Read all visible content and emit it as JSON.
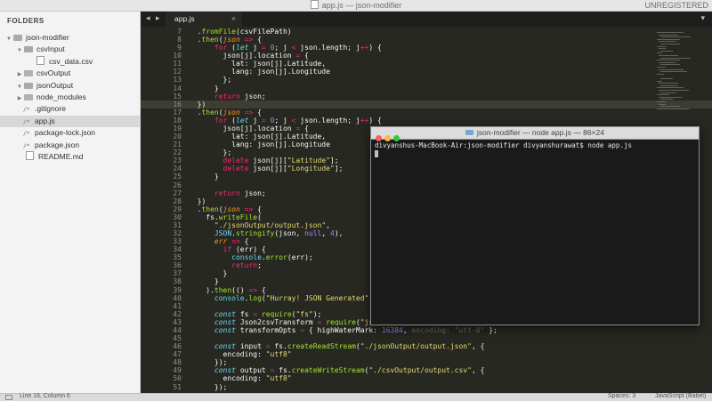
{
  "window": {
    "title": "app.js — json-modifier",
    "registration": "UNREGISTERED"
  },
  "sidebar": {
    "heading": "FOLDERS",
    "items": [
      {
        "label": "json-modifier",
        "kind": "folder-open",
        "depth": 0
      },
      {
        "label": "csvInput",
        "kind": "folder-open",
        "depth": 1
      },
      {
        "label": "csv_data.csv",
        "kind": "file",
        "depth": 2
      },
      {
        "label": "csvOutput",
        "kind": "folder-closed",
        "depth": 1
      },
      {
        "label": "jsonOutput",
        "kind": "folder-open",
        "depth": 1
      },
      {
        "label": "node_modules",
        "kind": "folder-closed",
        "depth": 1
      },
      {
        "label": ".gitignore",
        "kind": "js-file",
        "depth": 1
      },
      {
        "label": "app.js",
        "kind": "js-file",
        "depth": 1,
        "selected": true
      },
      {
        "label": "package-lock.json",
        "kind": "js-file",
        "depth": 1
      },
      {
        "label": "package.json",
        "kind": "js-file",
        "depth": 1
      },
      {
        "label": "README.md",
        "kind": "file",
        "depth": 1
      }
    ]
  },
  "tabs": {
    "nav_glyphs": "◂ ▸",
    "active_tab": "app.js",
    "close_glyph": "×",
    "dropdown_glyph": "▾"
  },
  "editor": {
    "active_line": 16,
    "lines": [
      {
        "n": "7",
        "html": "  .<span class=\"fn\">fromFile</span>(csvFilePath)"
      },
      {
        "n": "8",
        "html": "  .<span class=\"fn\">then</span>(<span class=\"pm\">json</span> <span class=\"kw\">=&gt;</span> {"
      },
      {
        "n": "9",
        "html": "      <span class=\"kw\">for</span> (<span class=\"it\">let</span> j <span class=\"kw\">=</span> <span class=\"nm\">0</span>; j <span class=\"kw\">&lt;</span> json.length; j<span class=\"kw\">++</span>) {"
      },
      {
        "n": "10",
        "html": "        json[j].location <span class=\"kw\">=</span> {"
      },
      {
        "n": "11",
        "html": "          lat: json[j].Latitude,"
      },
      {
        "n": "12",
        "html": "          lang: json[j].Longitude"
      },
      {
        "n": "13",
        "html": "        };"
      },
      {
        "n": "14",
        "html": "      }"
      },
      {
        "n": "15",
        "html": "      <span class=\"kw\">return</span> json;"
      },
      {
        "n": "16",
        "html": "  })"
      },
      {
        "n": "17",
        "html": "  .<span class=\"fn\">then</span>(<span class=\"pm\">json</span> <span class=\"kw\">=&gt;</span> {"
      },
      {
        "n": "18",
        "html": "      <span class=\"kw\">for</span> (<span class=\"it\">let</span> j <span class=\"kw\">=</span> <span class=\"nm\">0</span>; j <span class=\"kw\">&lt;</span> json.length; j<span class=\"kw\">++</span>) {"
      },
      {
        "n": "19",
        "html": "        json[j].location <span class=\"kw\">=</span> {"
      },
      {
        "n": "20",
        "html": "          lat: json[j].Latitude,"
      },
      {
        "n": "21",
        "html": "          lang: json[j].Longitude"
      },
      {
        "n": "22",
        "html": "        };"
      },
      {
        "n": "23",
        "html": "        <span class=\"kw\">delete</span> json[j][<span class=\"st\">\"Latitude\"</span>];"
      },
      {
        "n": "24",
        "html": "        <span class=\"kw\">delete</span> json[j][<span class=\"st\">\"Longitude\"</span>];"
      },
      {
        "n": "25",
        "html": "      }"
      },
      {
        "n": "26",
        "html": ""
      },
      {
        "n": "27",
        "html": "      <span class=\"kw\">return</span> json;"
      },
      {
        "n": "28",
        "html": "  })"
      },
      {
        "n": "29",
        "html": "  .<span class=\"fn\">then</span>(<span class=\"pm\">json</span> <span class=\"kw\">=&gt;</span> {"
      },
      {
        "n": "30",
        "html": "    fs.<span class=\"fn\">writeFile</span>("
      },
      {
        "n": "31",
        "html": "      <span class=\"st\">\"./jsonOutput/output.json\"</span>,"
      },
      {
        "n": "32",
        "html": "      <span class=\"sp\">JSON</span>.<span class=\"fn\">stringify</span>(json, <span class=\"nm\">null</span>, <span class=\"nm\">4</span>),"
      },
      {
        "n": "33",
        "html": "      <span class=\"pm\">err</span> <span class=\"kw\">=&gt;</span> {"
      },
      {
        "n": "34",
        "html": "        <span class=\"kw\">if</span> (err) {"
      },
      {
        "n": "35",
        "html": "          <span class=\"sp\">console</span>.<span class=\"fn\">error</span>(err);"
      },
      {
        "n": "36",
        "html": "          <span class=\"kw\">return</span>;"
      },
      {
        "n": "37",
        "html": "        }"
      },
      {
        "n": "38",
        "html": "      }"
      },
      {
        "n": "39",
        "html": "    ).<span class=\"fn\">then</span>(() <span class=\"kw\">=&gt;</span> {"
      },
      {
        "n": "40",
        "html": "      <span class=\"sp\">console</span>.<span class=\"fn\">log</span>(<span class=\"st\">\"Hurray! JSON Generated\"</span>);"
      },
      {
        "n": "41",
        "html": ""
      },
      {
        "n": "42",
        "html": "      <span class=\"it\">const</span> fs <span class=\"kw\">=</span> <span class=\"fn\">require</span>(<span class=\"st\">\"fs\"</span>);"
      },
      {
        "n": "43",
        "html": "      <span class=\"it\">const</span> Json2csvTransform <span class=\"kw\">=</span> <span class=\"fn\">require</span>(<span class=\"st\">\"json2csv\"</span>)"
      },
      {
        "n": "44",
        "html": "      <span class=\"it\">const</span> transformOpts <span class=\"kw\">=</span> { highWaterMark: <span class=\"nm\">16384</span>, <span class=\"cm\">encoding: \"utf-8\"</span> };"
      },
      {
        "n": "45",
        "html": ""
      },
      {
        "n": "46",
        "html": "      <span class=\"it\">const</span> input <span class=\"kw\">=</span> fs.<span class=\"fn\">createReadStream</span>(<span class=\"st\">\"./jsonOutput/output.json\"</span>, {"
      },
      {
        "n": "47",
        "html": "        encoding: <span class=\"st\">\"utf8\"</span>"
      },
      {
        "n": "48",
        "html": "      });"
      },
      {
        "n": "49",
        "html": "      <span class=\"it\">const</span> output <span class=\"kw\">=</span> fs.<span class=\"fn\">createWriteStream</span>(<span class=\"st\">\"./csvOutput/output.csv\"</span>, {"
      },
      {
        "n": "50",
        "html": "        encoding: <span class=\"st\">\"utf8\"</span>"
      },
      {
        "n": "51",
        "html": "      });"
      }
    ]
  },
  "terminal": {
    "title": "json-modifier — node app.js — 86×24",
    "prompt_line": "divyanshus-MacBook-Air:json-modifier divyanshurawat$ node app.js"
  },
  "status": {
    "position": "Line 16, Column 6",
    "spaces": "Spaces: 3",
    "syntax": "JavaScript (Babel)"
  },
  "colors": {
    "editor_bg": "#272822",
    "keyword": "#f92672",
    "function": "#a6e22e",
    "string": "#e6db74",
    "number": "#ae81ff",
    "sidebar_bg": "#f3f3f3",
    "terminal_bg": "#1a1a1a"
  }
}
